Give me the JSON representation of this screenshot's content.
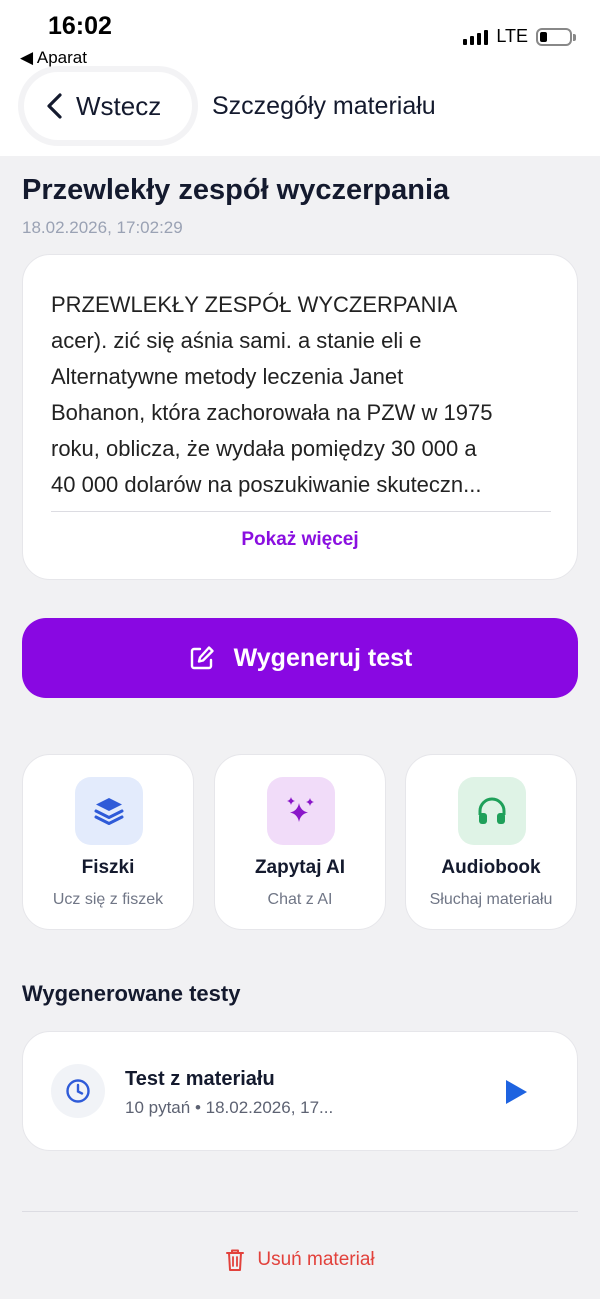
{
  "status_bar": {
    "time": "16:02",
    "back_app": "◀ Aparat",
    "network": "LTE"
  },
  "nav": {
    "back_label": "Wstecz",
    "title": "Szczegóły materiału"
  },
  "material": {
    "title": "Przewlekły zespół wyczerpania",
    "date": "18.02.2026, 17:02:29",
    "text_lines": [
      "PRZEWLEKŁY ZESPÓŁ WYCZERPANIA",
      "acer). zić się aśnia sami. a stanie eli e",
      "Alternatywne metody leczenia Janet",
      "Bohanon, która zachorowała na PZW w 1975",
      "roku, oblicza, że wydała pomiędzy 30 000 a",
      "40 000 dolarów na poszukiwanie skuteczn..."
    ],
    "show_more": "Pokaż więcej"
  },
  "generate_button": "Wygeneruj test",
  "tiles": [
    {
      "title": "Fiszki",
      "subtitle": "Ucz się z fiszek",
      "icon": "layers-icon",
      "bg": "#e3ebfc",
      "color": "#2f5bd8"
    },
    {
      "title": "Zapytaj AI",
      "subtitle": "Chat z AI",
      "icon": "sparkles-icon",
      "bg": "#f1dcf9",
      "color": "#8a17c9"
    },
    {
      "title": "Audiobook",
      "subtitle": "Słuchaj materiału",
      "icon": "headphones-icon",
      "bg": "#dff3e6",
      "color": "#1fa05a"
    }
  ],
  "tests_section": {
    "title": "Wygenerowane testy",
    "items": [
      {
        "title": "Test z materiału",
        "meta": "10 pytań • 18.02.2026, 17..."
      }
    ]
  },
  "delete_label": "Usuń materiał",
  "colors": {
    "accent": "#8908e2",
    "danger": "#e2413b",
    "play": "#1e63e0"
  }
}
